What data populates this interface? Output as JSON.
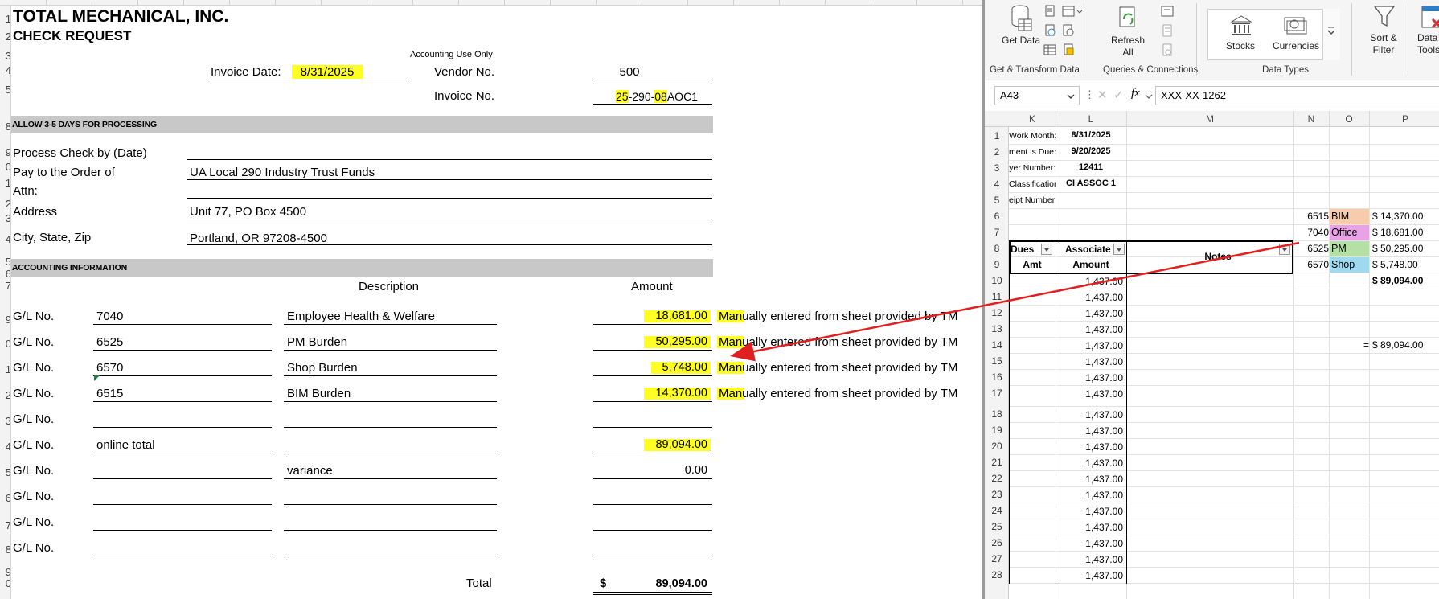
{
  "left_sheet": {
    "row_numbers": [
      "1",
      "2",
      "3",
      "4",
      "5",
      "",
      "8",
      "9",
      "0",
      "1",
      "2",
      "3",
      "4",
      "5",
      "6",
      "7",
      "",
      "9",
      "0",
      "1",
      "2",
      "3",
      "4",
      "5",
      "6",
      "7",
      "8",
      "9",
      "0"
    ],
    "company": "TOTAL MECHANICAL, INC.",
    "form_title": "CHECK REQUEST",
    "accounting_use_only": "Accounting Use Only",
    "invoice_date_label": "Invoice Date:",
    "invoice_date_value": "8/31/2025",
    "vendor_no_label": "Vendor No.",
    "vendor_no_value": "500",
    "invoice_no_label": "Invoice No.",
    "invoice_no_parts": [
      "25",
      "-290-",
      "08",
      "AOC1"
    ],
    "section_allow": "ALLOW 3-5 DAYS FOR PROCESSING",
    "process_check_label": "Process Check by (Date)",
    "pay_to_label": "Pay to the Order of",
    "pay_to_value": "UA Local 290 Industry Trust Funds",
    "attn_label": "Attn:",
    "address_label": "Address",
    "address_value": "Unit 77, PO Box 4500",
    "city_label": "City, State, Zip",
    "city_value": "Portland, OR  97208-4500",
    "section_accounting": "ACCOUNTING INFORMATION",
    "description_header": "Description",
    "amount_header": "Amount",
    "gl_label": "G/L No.",
    "gl_rows": [
      {
        "gl": "7040",
        "desc": "Employee Health & Welfare",
        "amount": "18,681.00",
        "note": "Manually entered from sheet provided by TM"
      },
      {
        "gl": "6525",
        "desc": "PM Burden",
        "amount": "50,295.00",
        "note": "Manually entered from sheet provided by TM"
      },
      {
        "gl": "6570",
        "desc": "Shop Burden",
        "amount": "5,748.00",
        "note": "Manually entered from sheet provided by TM"
      },
      {
        "gl": "6515",
        "desc": "BIM Burden",
        "amount": "14,370.00",
        "note": "Manually entered from sheet provided by TM"
      },
      {
        "gl": "",
        "desc": "",
        "amount": "",
        "note": ""
      },
      {
        "gl": "online total",
        "desc": "",
        "amount": "89,094.00",
        "note": ""
      },
      {
        "gl": "",
        "desc": "variance",
        "amount": "0.00",
        "note": ""
      },
      {
        "gl": "",
        "desc": "",
        "amount": "",
        "note": ""
      },
      {
        "gl": "",
        "desc": "",
        "amount": "",
        "note": ""
      },
      {
        "gl": "",
        "desc": "",
        "amount": "",
        "note": ""
      }
    ],
    "total_label": "Total",
    "total_currency": "$",
    "total_value": "89,094.00"
  },
  "excel": {
    "ribbon": {
      "get_data": "Get Data",
      "refresh_all": "Refresh All",
      "stocks": "Stocks",
      "currencies": "Currencies",
      "sort_filter": "Sort & Filter",
      "data_tools": "Data Tools",
      "group_get_transform": "Get & Transform Data",
      "group_queries": "Queries & Connections",
      "group_data_types": "Data Types"
    },
    "name_box": "A43",
    "fx_label": "fx",
    "formula_value": "XXX-XX-1262",
    "columns": [
      "K",
      "L",
      "M",
      "N",
      "O",
      "P"
    ],
    "rows": [
      "1",
      "2",
      "3",
      "4",
      "5",
      "6",
      "7",
      "8",
      "9",
      "10",
      "11",
      "12",
      "13",
      "14",
      "15",
      "16",
      "17",
      "18",
      "19",
      "20",
      "21",
      "22",
      "23",
      "24",
      "25",
      "26",
      "27",
      "28"
    ],
    "header_info": [
      {
        "label": "Work Month:",
        "value": "8/31/2025"
      },
      {
        "label": "ment is Due:",
        "value": "9/20/2025"
      },
      {
        "label": "yer Number:",
        "value": "12411"
      },
      {
        "label": "Classification:",
        "value": "CI ASSOC 1"
      },
      {
        "label": "eipt Number:",
        "value": ""
      }
    ],
    "table_headers": {
      "dues": "Dues",
      "associate": "Associate",
      "notes": "Notes",
      "amt": "Amt",
      "amount": "Amount"
    },
    "associate_amount": "1,437.00",
    "summary": [
      {
        "code": "6515",
        "cat": "BIM",
        "amount": "$ 14,370.00",
        "color": "#f8cbad"
      },
      {
        "code": "7040",
        "cat": "Office",
        "amount": "$ 18,681.00",
        "color": "#e8a3e6"
      },
      {
        "code": "6525",
        "cat": "PM",
        "amount": "$ 50,295.00",
        "color": "#b4e0a6"
      },
      {
        "code": "6570",
        "cat": "Shop",
        "amount": "$   5,748.00",
        "color": "#9ed9ef"
      }
    ],
    "summary_total": "$ 89,094.00",
    "check_equals": "=",
    "check_total": "$ 89,094.00"
  },
  "colors": {
    "highlight": "#ffff22",
    "arrow": "#e02020",
    "gray_bar": "#c8c8c8"
  }
}
